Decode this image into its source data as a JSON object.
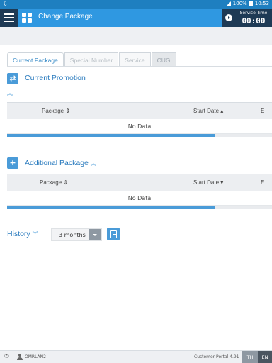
{
  "status_bar": {
    "battery": "100%",
    "time": "10:53"
  },
  "header": {
    "title": "Change Package",
    "service_time_label": "Service Time",
    "service_time_value": "00:00"
  },
  "tabs": [
    {
      "label": "Current Package",
      "state": "active"
    },
    {
      "label": "Special Number",
      "state": "disabled"
    },
    {
      "label": "Service",
      "state": "disabled"
    },
    {
      "label": "CUG",
      "state": "disabled"
    }
  ],
  "current_promotion": {
    "title": "Current Promotion",
    "columns": {
      "package": "Package ⇕",
      "start_date": "Start Date ▴",
      "end_date": "E"
    },
    "empty_text": "No Data"
  },
  "additional_package": {
    "title": "Additional Package",
    "columns": {
      "package": "Package ⇕",
      "start_date": "Start Date ▾",
      "end_date": "E"
    },
    "empty_text": "No Data"
  },
  "history": {
    "title": "History",
    "period_value": "3 months"
  },
  "footer": {
    "user": "OMRLAN2",
    "portal": "Customer Portal 4.91",
    "lang_th": "TH",
    "lang_en": "EN"
  },
  "colors": {
    "header": "#2f98e1",
    "status_bar": "#1e7fc0",
    "accent": "#4a9bd8",
    "title_text": "#2779bd",
    "dark_box": "#1e3a55"
  }
}
